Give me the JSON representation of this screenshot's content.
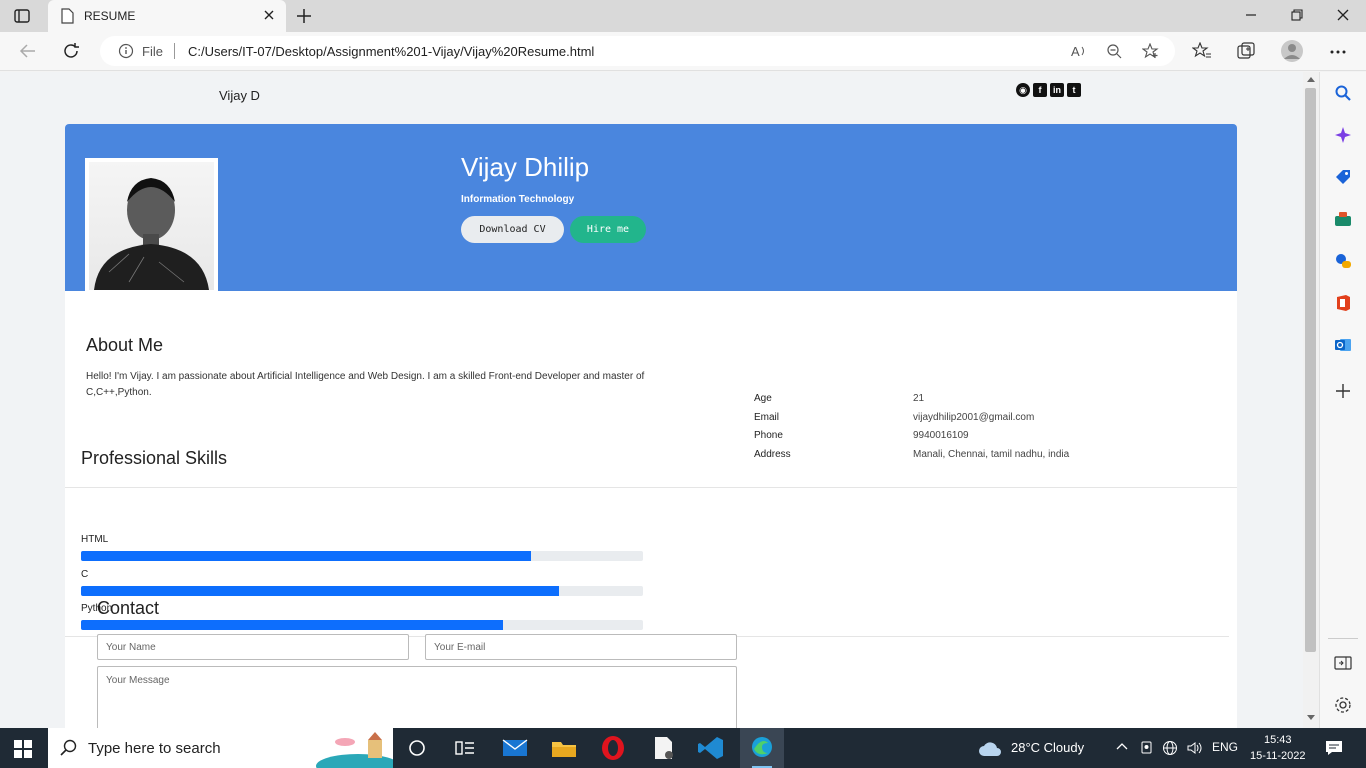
{
  "browser": {
    "tab_title": "RESUME",
    "file_label": "File",
    "url": "C:/Users/IT-07/Desktop/Assignment%201-Vijay/Vijay%20Resume.html"
  },
  "page": {
    "brand": "Vijay D",
    "social": [
      "github-icon",
      "facebook-icon",
      "linkedin-icon",
      "twitter-icon"
    ],
    "hero": {
      "name": "Vijay Dhilip",
      "role": "Information Technology",
      "download_label": "Download CV",
      "hire_label": "Hire me",
      "bg_color": "#4a86de"
    },
    "about": {
      "heading": "About Me",
      "text": "Hello! I'm Vijay. I am passionate about Artificial Intelligence and Web Design. I am a skilled Front-end Developer and master of C,C++,Python."
    },
    "info": {
      "age_label": "Age",
      "age": "21",
      "email_label": "Email",
      "email": "vijaydhilip2001@gmail.com",
      "phone_label": "Phone",
      "phone": "9940016109",
      "address_label": "Address",
      "address": "Manali, Chennai, tamil nadhu, india"
    },
    "skills": {
      "heading": "Professional Skills",
      "items": [
        {
          "name": "HTML",
          "level": 0.8
        },
        {
          "name": "C",
          "level": 0.85
        },
        {
          "name": "Python",
          "level": 0.75
        }
      ]
    },
    "contact": {
      "heading": "Contact",
      "name_placeholder": "Your Name",
      "email_placeholder": "Your E-mail",
      "message_placeholder": "Your Message"
    }
  },
  "taskbar": {
    "search_placeholder": "Type here to search",
    "weather": "28°C  Cloudy",
    "lang": "ENG",
    "time": "15:43",
    "date": "15-11-2022"
  }
}
